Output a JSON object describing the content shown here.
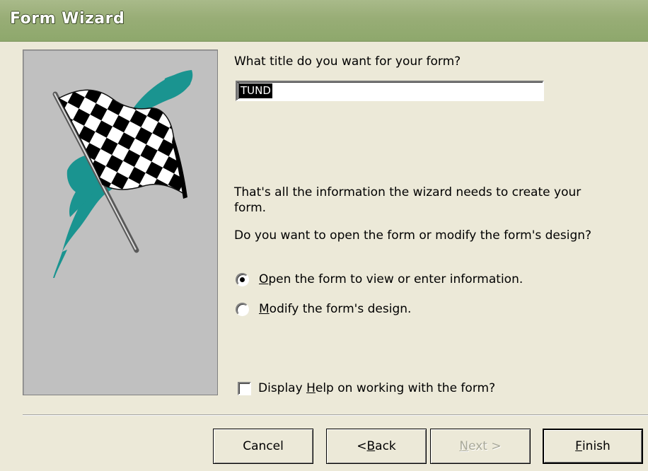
{
  "window": {
    "title": "Form Wizard"
  },
  "form_title": {
    "prompt": "What title do you want for your form?",
    "value": "TUND"
  },
  "info": {
    "line1": "That's all the information the wizard needs to create your form.",
    "line2": "Do you want to open the form or modify the form's design?"
  },
  "options": [
    {
      "pre": "",
      "key": "O",
      "post": "pen the form to view or enter information.",
      "selected": true
    },
    {
      "pre": "",
      "key": "M",
      "post": "odify the form's design.",
      "selected": false
    }
  ],
  "help_checkbox": {
    "pre": "Display ",
    "key": "H",
    "post": "elp on working with the form?",
    "checked": false
  },
  "buttons": {
    "cancel": {
      "label": "Cancel"
    },
    "back": {
      "pre": "< ",
      "key": "B",
      "post": "ack"
    },
    "next": {
      "pre": "",
      "key": "N",
      "post": "ext >",
      "enabled": false
    },
    "finish": {
      "pre": "",
      "key": "F",
      "post": "inish"
    }
  },
  "art": {
    "icon": "checkered-flag-icon",
    "accent": "#1a9490"
  }
}
